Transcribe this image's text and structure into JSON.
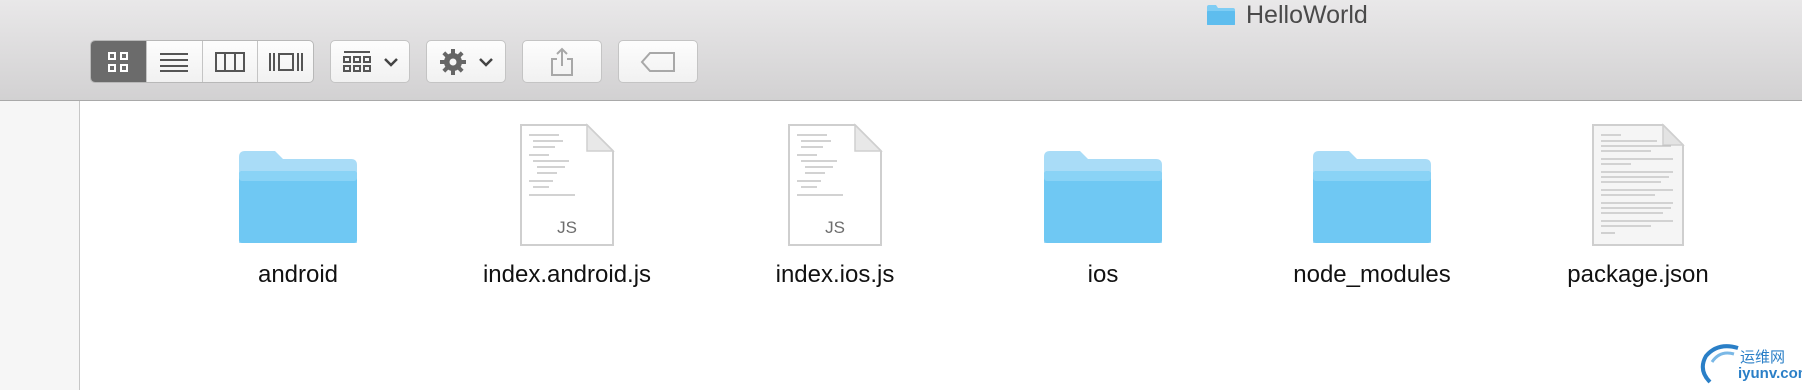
{
  "window": {
    "title": "HelloWorld",
    "title_icon": "folder-icon"
  },
  "toolbar": {
    "view_modes": [
      {
        "name": "icon-view",
        "icon": "grid-icon",
        "active": true
      },
      {
        "name": "list-view",
        "icon": "list-icon",
        "active": false
      },
      {
        "name": "column-view",
        "icon": "columns-icon",
        "active": false
      },
      {
        "name": "cover-flow-view",
        "icon": "cover-flow-icon",
        "active": false
      }
    ],
    "arrange_icon": "arrange-grid-icon",
    "action_icon": "gear-icon",
    "share_icon": "share-icon",
    "tag_icon": "tag-icon"
  },
  "files": [
    {
      "name": "android",
      "kind": "folder"
    },
    {
      "name": "index.android.js",
      "kind": "js",
      "badge": "JS"
    },
    {
      "name": "index.ios.js",
      "kind": "js",
      "badge": "JS"
    },
    {
      "name": "ios",
      "kind": "folder"
    },
    {
      "name": "node_modules",
      "kind": "folder"
    },
    {
      "name": "package.json",
      "kind": "text"
    }
  ],
  "watermark": {
    "cn": "运维网",
    "en": "iyunv.com"
  },
  "colors": {
    "folder_top": "#a9dcf7",
    "folder_body": "#6fc8f3",
    "active_segment": "#6b6b6b",
    "watermark": "#2a7fc7"
  }
}
